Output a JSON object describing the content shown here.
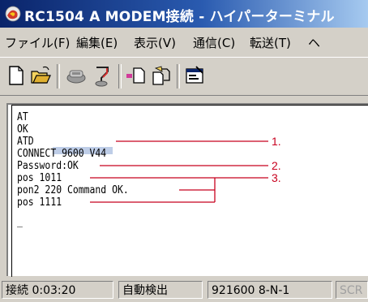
{
  "window": {
    "title": "RC1504 A MODEM接続 - ハイパーターミナル"
  },
  "menu": [
    {
      "label": "ファイル(F)"
    },
    {
      "label": "編集(E)"
    },
    {
      "label": "表示(V)"
    },
    {
      "label": "通信(C)"
    },
    {
      "label": "転送(T)"
    },
    {
      "label": "ヘ"
    }
  ],
  "toolbar": {
    "buttons": [
      {
        "icon": "new-file-icon"
      },
      {
        "icon": "open-folder-icon"
      },
      {
        "icon": "connect-icon"
      },
      {
        "icon": "disconnect-icon"
      },
      {
        "icon": "send-icon"
      },
      {
        "icon": "receive-icon"
      },
      {
        "icon": "properties-icon"
      }
    ]
  },
  "terminal": {
    "lines": [
      "AT",
      "OK",
      "ATD",
      "CONNECT 9600 V44",
      "Password:OK",
      "pos 1011",
      "pon2 220 Command OK.",
      "pos 1111"
    ],
    "cursor": "_"
  },
  "annotations": {
    "color": "#c8001e",
    "labels": [
      "1.",
      "2.",
      "3."
    ]
  },
  "status": {
    "connection_time": "接続 0:03:20",
    "detect": "自動検出",
    "port_settings": "921600 8-N-1",
    "scroll": "SCR"
  }
}
